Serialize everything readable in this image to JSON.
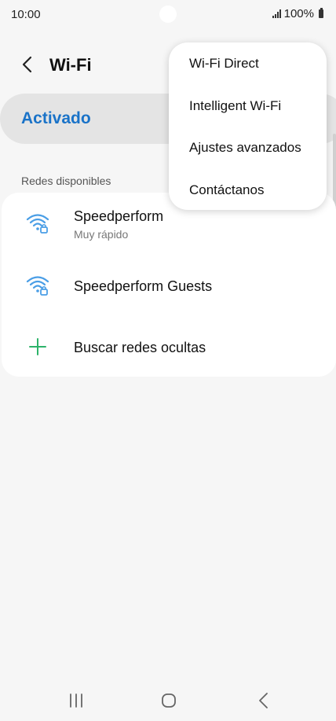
{
  "status": {
    "time": "10:00",
    "battery": "100%"
  },
  "header": {
    "title": "Wi-Fi"
  },
  "toggle": {
    "label": "Activado"
  },
  "networks": {
    "section_label": "Redes disponibles",
    "items": [
      {
        "name": "Speedperform",
        "subtitle": "Muy rápido",
        "icon": "wifi-lock-icon"
      },
      {
        "name": "Speedperform Guests",
        "subtitle": "",
        "icon": "wifi-lock-icon"
      },
      {
        "name": "Buscar redes ocultas",
        "subtitle": "",
        "icon": "plus-icon"
      }
    ]
  },
  "menu": {
    "items": [
      {
        "label": "Wi-Fi Direct"
      },
      {
        "label": "Intelligent Wi-Fi"
      },
      {
        "label": "Ajustes avanzados"
      },
      {
        "label": "Contáctanos"
      }
    ]
  },
  "colors": {
    "accent": "#1a73c8",
    "wifi": "#4a9ee6",
    "plus": "#2db36a"
  }
}
